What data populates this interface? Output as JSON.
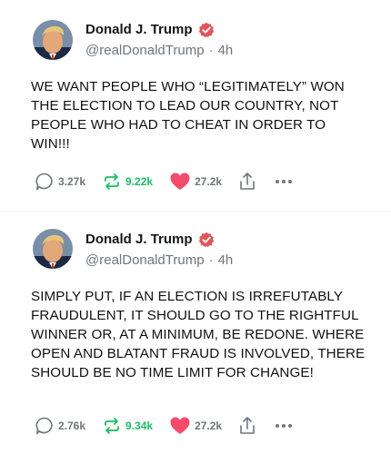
{
  "posts": [
    {
      "author": "Donald J. Trump",
      "handle": "@realDonaldTrump",
      "time": "4h",
      "text": "WE WANT PEOPLE WHO “LEGITIMATELY” WON THE ELECTION TO LEAD OUR COUNTRY, NOT PEOPLE WHO HAD TO CHEAT IN ORDER TO WIN!!!",
      "replies": "3.27k",
      "reposts": "9.22k",
      "likes": "27.2k"
    },
    {
      "author": "Donald J. Trump",
      "handle": "@realDonaldTrump",
      "time": "4h",
      "text": "SIMPLY PUT, IF AN ELECTION IS IRREFUTABLY FRAUDULENT, IT SHOULD GO TO THE RIGHTFUL WINNER OR, AT A MINIMUM, BE REDONE. WHERE OPEN AND BLATANT FRAUD IS INVOLVED, THERE SHOULD BE NO TIME LIMIT FOR CHANGE!",
      "replies": "2.76k",
      "reposts": "9.34k",
      "likes": "27.2k"
    }
  ],
  "separator": "·",
  "colors": {
    "verified": "#e2555a",
    "repost": "#17bf63",
    "like": "#f44b6b",
    "muted": "#6e767d"
  },
  "icons": [
    "avatar",
    "verified-badge-icon",
    "reply-icon",
    "repost-icon",
    "heart-icon",
    "share-icon",
    "more-icon"
  ]
}
